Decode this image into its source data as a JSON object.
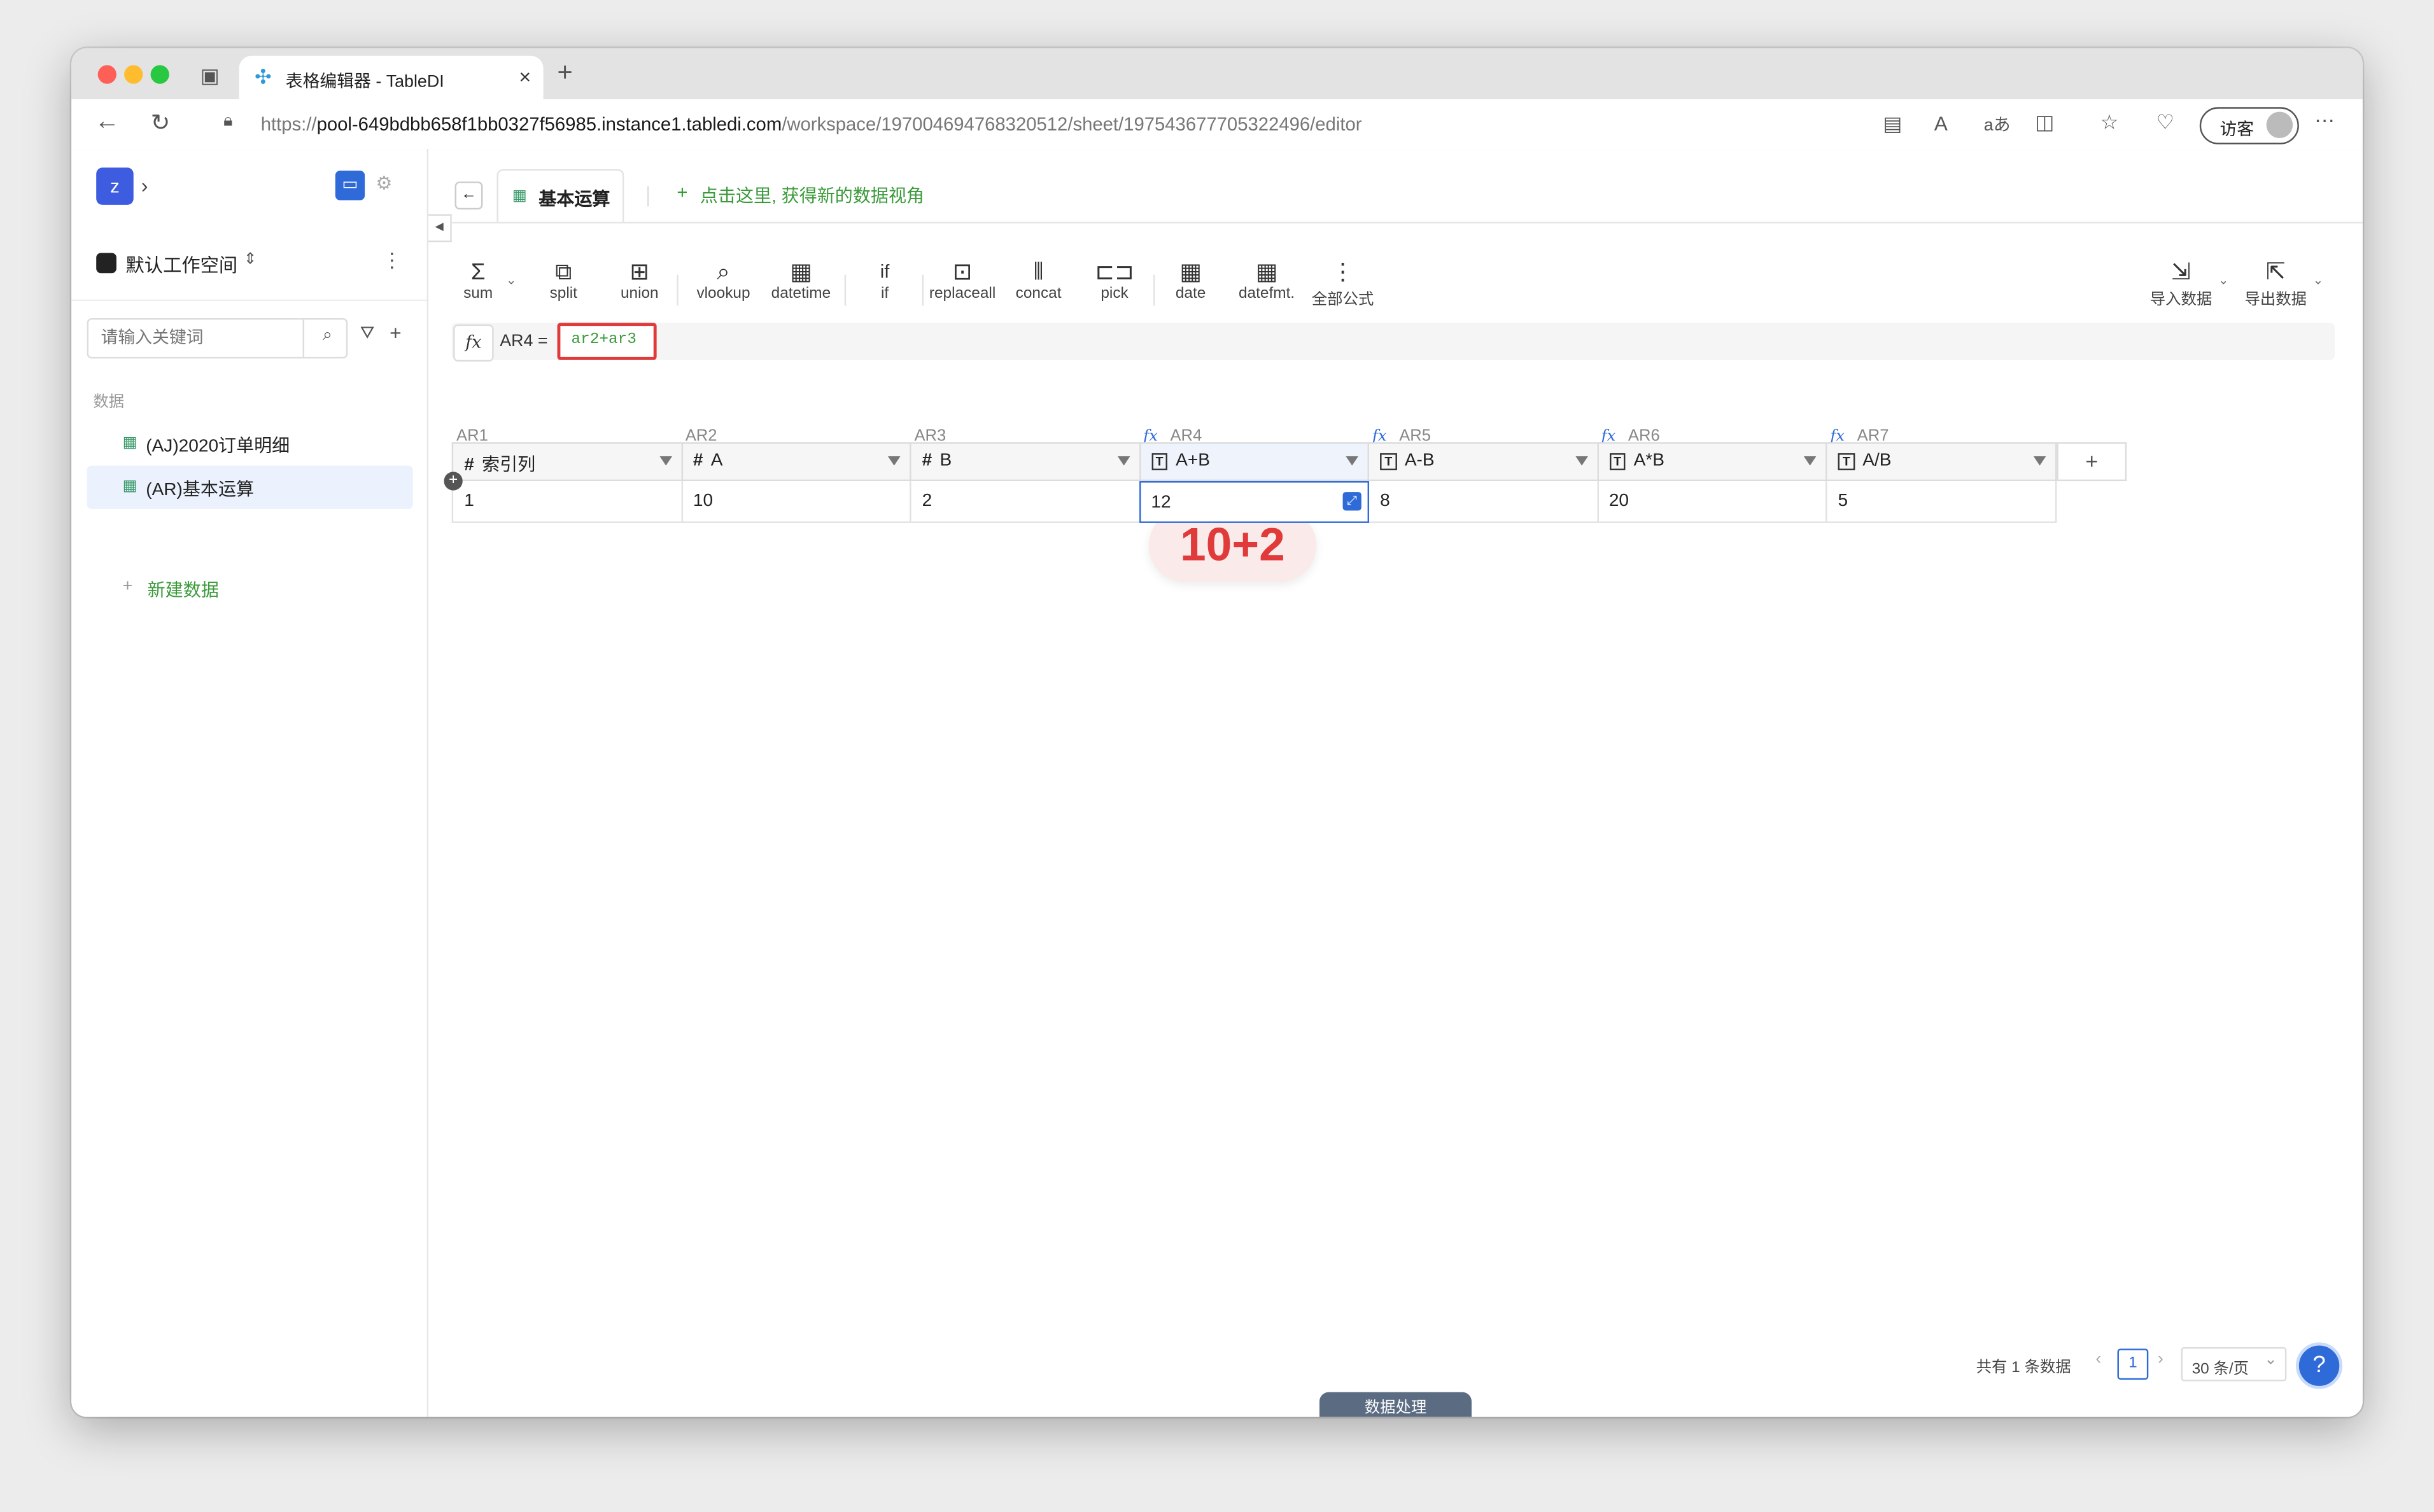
{
  "browser": {
    "tab_title": "表格编辑器 - TableDI",
    "url_prefix": "https://",
    "url_host": "pool-649bdbb658f1bb0327f56985.instance1.tabledi.com",
    "url_path": "/workspace/197004694768320512/sheet/197543677705322496/editor",
    "guest_label": "访客"
  },
  "sidebar": {
    "avatar_letter": "z",
    "workspace_name": "默认工作空间",
    "search_placeholder": "请输入关键词",
    "section_label": "数据",
    "items": [
      {
        "label": "(AJ)2020订单明细"
      },
      {
        "label": "(AR)基本运算"
      }
    ],
    "new_data_label": "新建数据"
  },
  "main": {
    "active_view_tab": "基本运算",
    "new_view_hint": "点击这里, 获得新的数据视角",
    "toolbar": [
      {
        "label": "sum",
        "icon": "sigma-icon"
      },
      {
        "label": "split",
        "icon": "split-icon"
      },
      {
        "label": "union",
        "icon": "union-icon"
      },
      {
        "label": "vlookup",
        "icon": "search-icon"
      },
      {
        "label": "datetime",
        "icon": "calendar-icon"
      },
      {
        "label": "if",
        "icon": "if-icon"
      },
      {
        "label": "replaceall",
        "icon": "replace-icon"
      },
      {
        "label": "concat",
        "icon": "concat-icon"
      },
      {
        "label": "pick",
        "icon": "pick-icon"
      },
      {
        "label": "date",
        "icon": "calendar-icon"
      },
      {
        "label": "datefmt.",
        "icon": "calendar-format-icon"
      },
      {
        "label": "全部公式",
        "icon": "more-vertical-icon"
      }
    ],
    "import_label": "导入数据",
    "export_label": "导出数据",
    "formula_bar": {
      "fx_label": "fx",
      "target": "AR4 =",
      "expression": "ar2+ar3"
    },
    "columns": [
      {
        "id": "AR1",
        "name": "索引列",
        "type": "#",
        "is_formula": false
      },
      {
        "id": "AR2",
        "name": "A",
        "type": "#",
        "is_formula": false
      },
      {
        "id": "AR3",
        "name": "B",
        "type": "#",
        "is_formula": false
      },
      {
        "id": "AR4",
        "name": "A+B",
        "type": "T",
        "is_formula": true
      },
      {
        "id": "AR5",
        "name": "A-B",
        "type": "T",
        "is_formula": true
      },
      {
        "id": "AR6",
        "name": "A*B",
        "type": "T",
        "is_formula": true
      },
      {
        "id": "AR7",
        "name": "A/B",
        "type": "T",
        "is_formula": true
      }
    ],
    "rows": [
      [
        "1",
        "10",
        "2",
        "12",
        "8",
        "20",
        "5"
      ]
    ],
    "add_column_label": "+",
    "annotation": "10+2",
    "pagination": {
      "total_text": "共有 1 条数据",
      "current_page": "1",
      "page_size": "30 条/页"
    },
    "bottom_tab": "数据处理",
    "help_label": "?"
  },
  "colors": {
    "accent_blue": "#2f6bd8",
    "green": "#3a9a3a",
    "highlight_red": "#e03a3a"
  }
}
